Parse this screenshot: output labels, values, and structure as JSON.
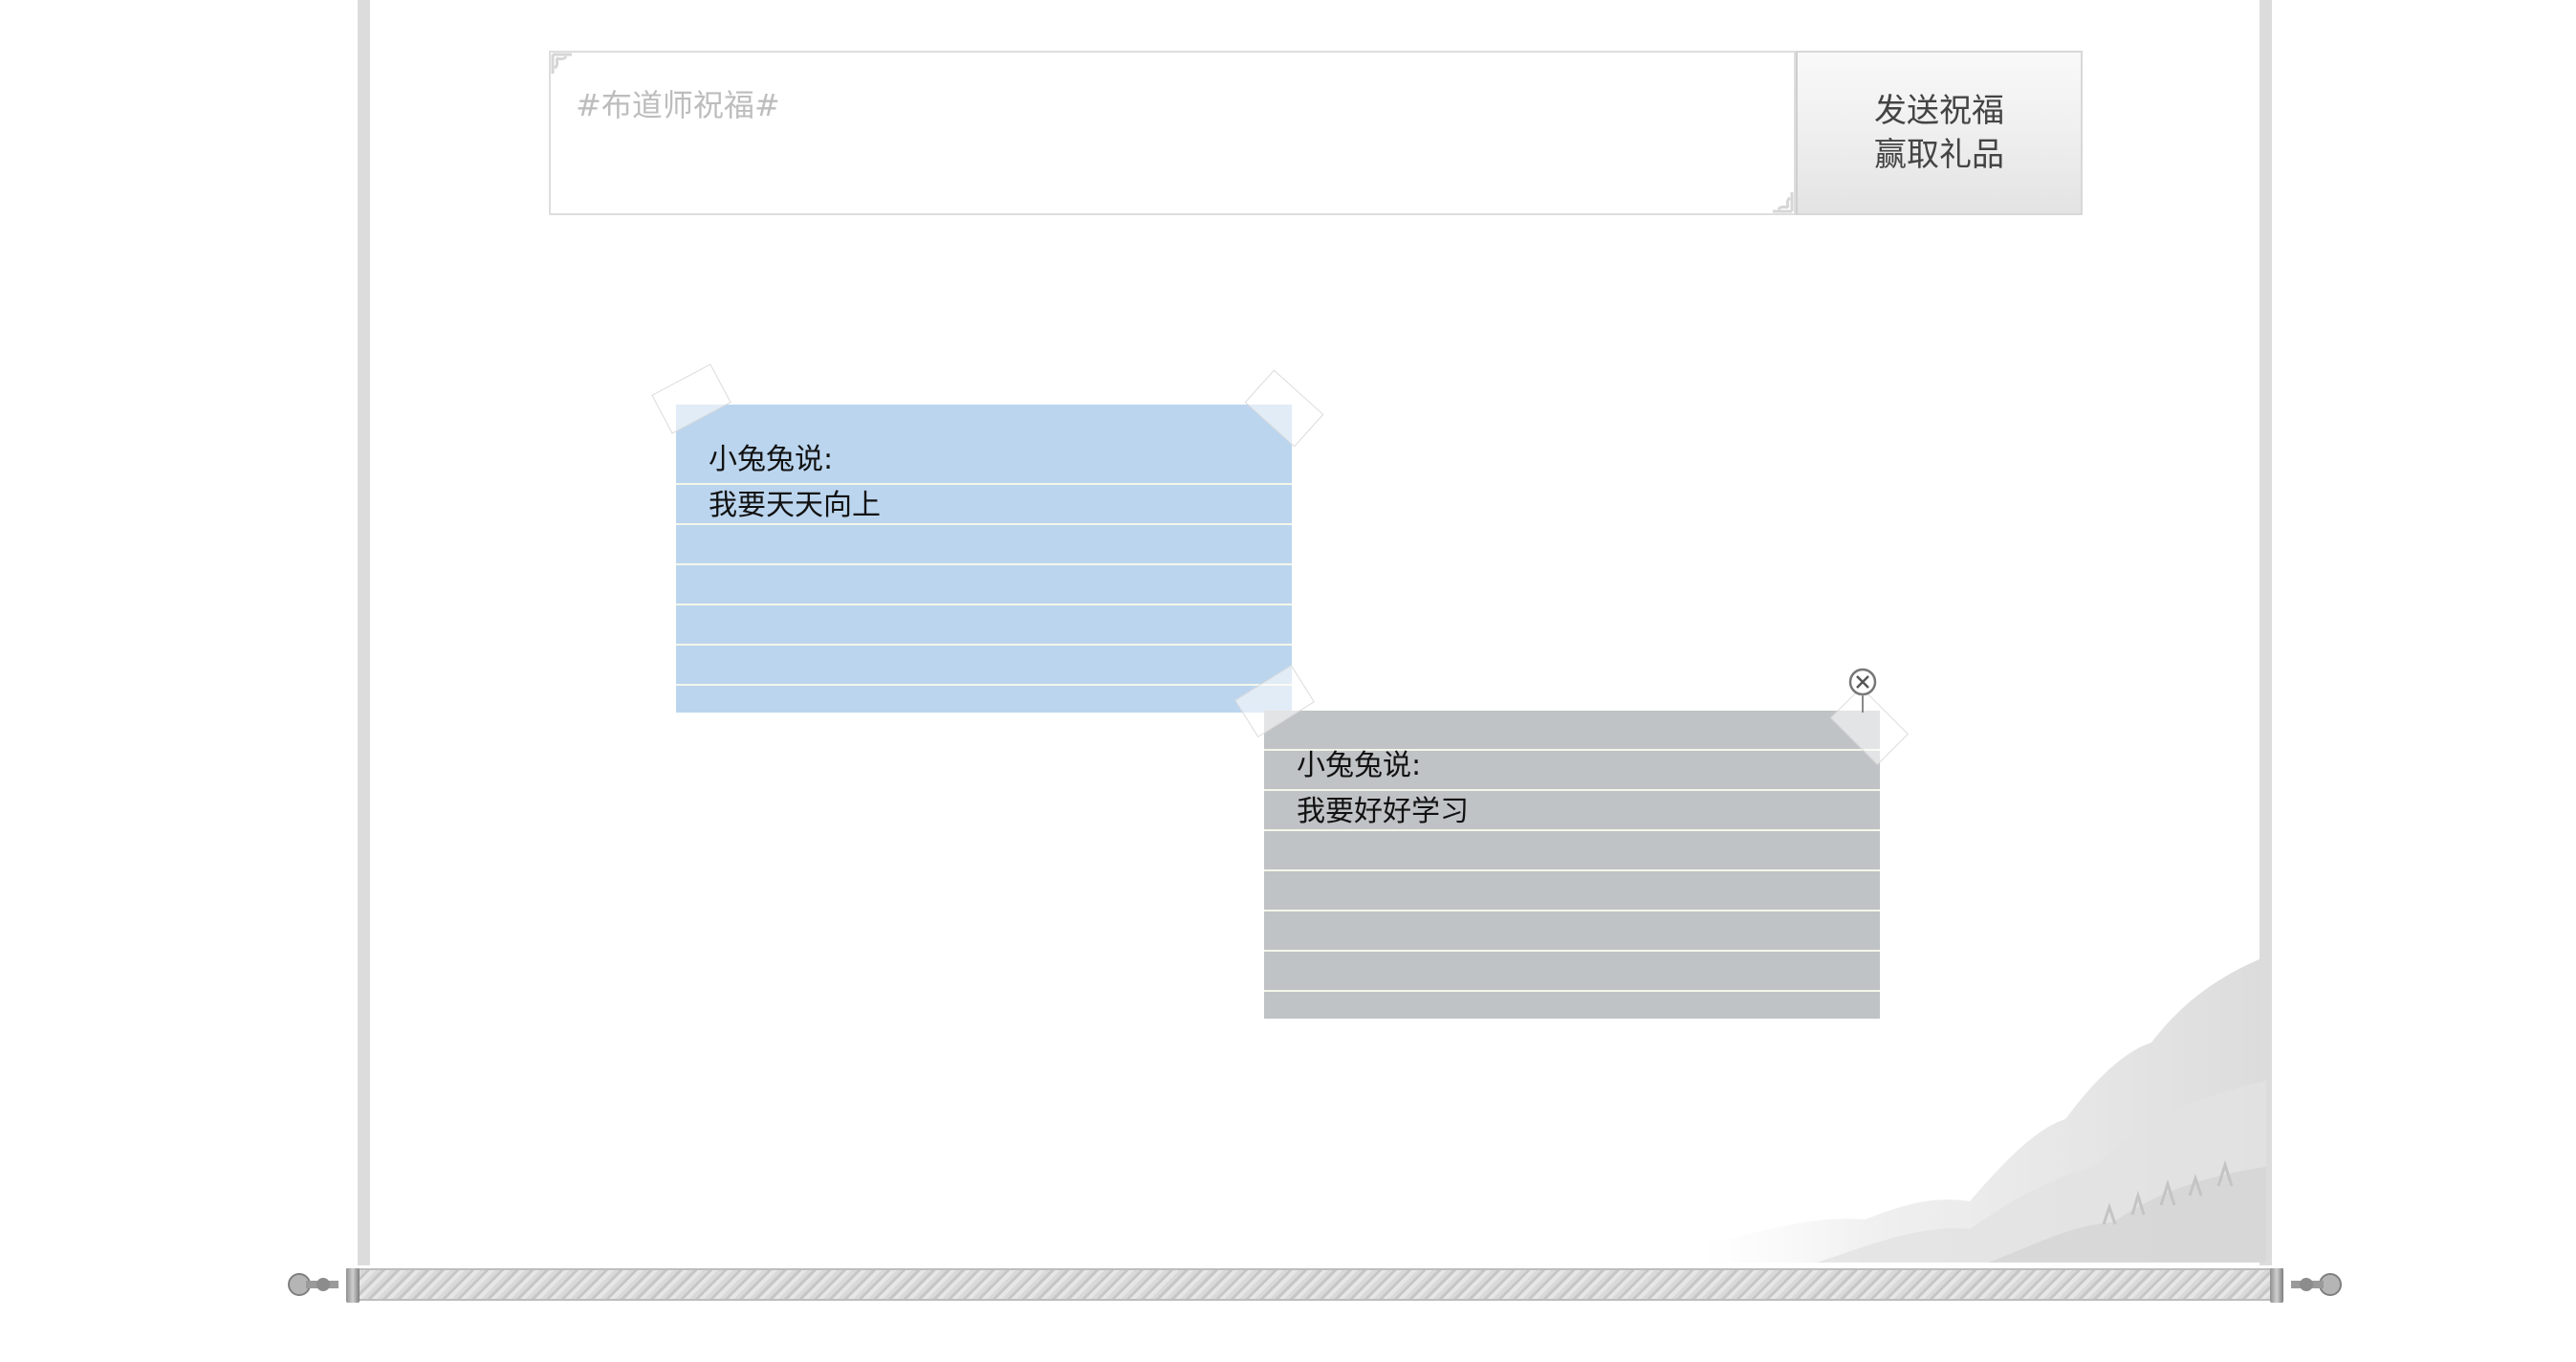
{
  "wish_form": {
    "placeholder": "#布道师祝福#",
    "send_button": {
      "line1": "发送祝福",
      "line2": "赢取礼品"
    }
  },
  "notes": [
    {
      "color": "#bcd5ee",
      "author": "小兔兔说:",
      "message": "我要天天向上"
    },
    {
      "color": "#c0c3c5",
      "author": "小兔兔说:",
      "message": "我要好好学习",
      "close_icon": "close-icon"
    }
  ],
  "colors": {
    "frame": "#dcdcdc",
    "note_line": "#f3f7e9",
    "button_text": "#444444"
  }
}
